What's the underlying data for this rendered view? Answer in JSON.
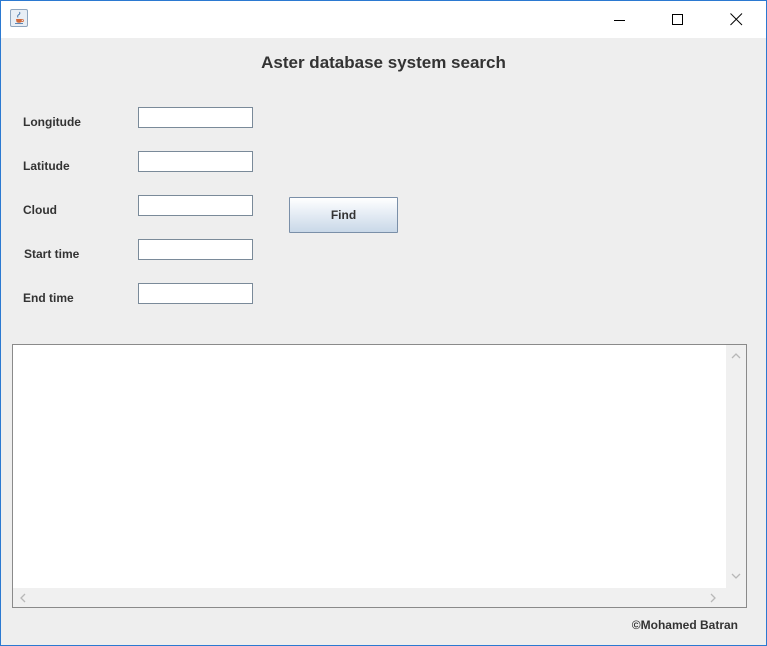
{
  "window": {
    "controls": [
      "minimize-icon",
      "maximize-icon",
      "close-icon"
    ]
  },
  "main": {
    "heading": "Aster database system search"
  },
  "form": {
    "fields": [
      {
        "label": "Longitude",
        "value": ""
      },
      {
        "label": "Latitude",
        "value": ""
      },
      {
        "label": "Cloud",
        "value": ""
      },
      {
        "label": "Start time",
        "value": ""
      },
      {
        "label": "End time",
        "value": ""
      }
    ],
    "find_label": "Find"
  },
  "output": {
    "text": ""
  },
  "footer": {
    "copyright": "©Mohamed Batran"
  }
}
